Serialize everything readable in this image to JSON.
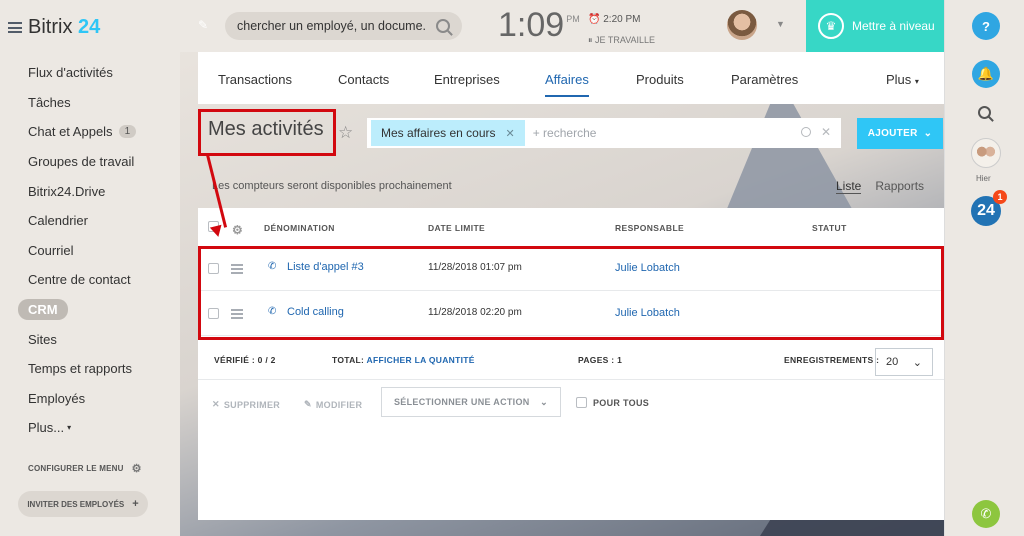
{
  "brand": {
    "name_a": "Bitrix",
    "name_b": "24"
  },
  "sidebar": {
    "items": [
      {
        "label": "Flux d'activités"
      },
      {
        "label": "Tâches"
      },
      {
        "label": "Chat et Appels",
        "counter": "1"
      },
      {
        "label": "Groupes de travail"
      },
      {
        "label": "Bitrix24.Drive"
      },
      {
        "label": "Calendrier"
      },
      {
        "label": "Courriel"
      },
      {
        "label": "Centre de contact"
      },
      {
        "label": "CRM",
        "active": true
      },
      {
        "label": "Sites"
      },
      {
        "label": "Temps et rapports"
      },
      {
        "label": "Employés"
      },
      {
        "label": "Plus..."
      }
    ],
    "configure_label": "CONFIGURER LE MENU",
    "invite_label": "INVITER DES EMPLOYÉS"
  },
  "topbar": {
    "search_value": "chercher un employé, un docume...",
    "clock_time": "1:09",
    "clock_ampm": "PM",
    "alarm_time": "2:20 PM",
    "work_status": "JE TRAVAILLE",
    "upgrade_label": "Mettre à niveau"
  },
  "rightbar": {
    "help": "?",
    "recent_label": "Hier",
    "b24_label": "24",
    "b24_badge": "1"
  },
  "tabs": [
    {
      "label": "Transactions"
    },
    {
      "label": "Contacts"
    },
    {
      "label": "Entreprises"
    },
    {
      "label": "Affaires",
      "active": true
    },
    {
      "label": "Produits"
    },
    {
      "label": "Paramètres"
    },
    {
      "label": "Plus"
    }
  ],
  "page": {
    "title": "Mes activités",
    "filter_chip": "Mes affaires en cours",
    "filter_placeholder": "+ recherche",
    "add_button": "AJOUTER",
    "notice": "Les compteurs seront disponibles prochainement",
    "view_list": "Liste",
    "view_reports": "Rapports"
  },
  "grid": {
    "columns": [
      "DÉNOMINATION",
      "DATE LIMITE",
      "RESPONSABLE",
      "STATUT"
    ],
    "rows": [
      {
        "name": "Liste d'appel #3",
        "deadline": "11/28/2018 01:07 pm",
        "responsible": "Julie Lobatch",
        "status": ""
      },
      {
        "name": "Cold calling",
        "deadline": "11/28/2018 02:20 pm",
        "responsible": "Julie Lobatch",
        "status": ""
      }
    ],
    "verified_label": "VÉRIFIÉ :",
    "verified_value": "0 / 2",
    "total_label": "TOTAL:",
    "total_link": "AFFICHER LA QUANTITÉ",
    "pages_label": "PAGES :",
    "pages_value": "1",
    "records_label": "ENREGISTREMENTS :",
    "records_value": "20"
  },
  "actions": {
    "delete_label": "SUPPRIMER",
    "edit_label": "MODIFIER",
    "select_action": "SÉLECTIONNER UNE ACTION",
    "for_all_label": "POUR TOUS"
  },
  "colors": {
    "accent": "#2fc6f6",
    "link": "#2067b0",
    "highlight": "#d2080f",
    "upgrade": "#37d7c6"
  }
}
